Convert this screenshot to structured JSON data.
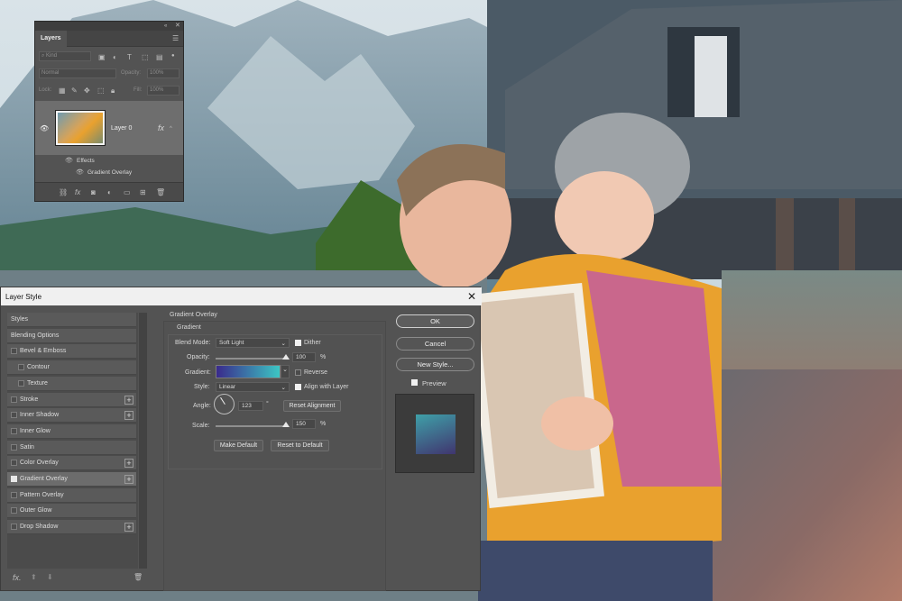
{
  "layers_panel": {
    "title": "Layers",
    "filter_kind": "Kind",
    "blend_mode": "Normal",
    "opacity_label": "Opacity:",
    "opacity_value": "100%",
    "lock_label": "Lock:",
    "fill_label": "Fill:",
    "fill_value": "100%",
    "layer_name": "Layer 0",
    "fx_label": "fx",
    "effects_label": "Effects",
    "effect_item": "Gradient Overlay"
  },
  "dialog": {
    "title": "Layer Style",
    "style_list": [
      {
        "label": "Styles",
        "checkbox": false,
        "checked": false,
        "plus": false,
        "indent": false
      },
      {
        "label": "Blending Options",
        "checkbox": false,
        "checked": false,
        "plus": false,
        "indent": false
      },
      {
        "label": "Bevel & Emboss",
        "checkbox": true,
        "checked": false,
        "plus": false,
        "indent": false
      },
      {
        "label": "Contour",
        "checkbox": true,
        "checked": false,
        "plus": false,
        "indent": true
      },
      {
        "label": "Texture",
        "checkbox": true,
        "checked": false,
        "plus": false,
        "indent": true
      },
      {
        "label": "Stroke",
        "checkbox": true,
        "checked": false,
        "plus": true,
        "indent": false
      },
      {
        "label": "Inner Shadow",
        "checkbox": true,
        "checked": false,
        "plus": true,
        "indent": false
      },
      {
        "label": "Inner Glow",
        "checkbox": true,
        "checked": false,
        "plus": false,
        "indent": false
      },
      {
        "label": "Satin",
        "checkbox": true,
        "checked": false,
        "plus": false,
        "indent": false
      },
      {
        "label": "Color Overlay",
        "checkbox": true,
        "checked": false,
        "plus": true,
        "indent": false
      },
      {
        "label": "Gradient Overlay",
        "checkbox": true,
        "checked": true,
        "plus": true,
        "indent": false
      },
      {
        "label": "Pattern Overlay",
        "checkbox": true,
        "checked": false,
        "plus": false,
        "indent": false
      },
      {
        "label": "Outer Glow",
        "checkbox": true,
        "checked": false,
        "plus": false,
        "indent": false
      },
      {
        "label": "Drop Shadow",
        "checkbox": true,
        "checked": false,
        "plus": true,
        "indent": false
      }
    ],
    "section_title": "Gradient Overlay",
    "group_title": "Gradient",
    "blend_mode_label": "Blend Mode:",
    "blend_mode_value": "Soft Light",
    "dither_label": "Dither",
    "opacity_label": "Opacity:",
    "opacity_value": "100",
    "opacity_fraction": 1.0,
    "percent": "%",
    "gradient_label": "Gradient:",
    "reverse_label": "Reverse",
    "style_label": "Style:",
    "style_value": "Linear",
    "align_label": "Align with Layer",
    "angle_label": "Angle:",
    "angle_value": "123",
    "degree": "°",
    "reset_alignment": "Reset Alignment",
    "scale_label": "Scale:",
    "scale_value": "150",
    "scale_fraction": 1.0,
    "make_default": "Make Default",
    "reset_default": "Reset to Default",
    "ok": "OK",
    "cancel": "Cancel",
    "new_style": "New Style...",
    "preview_label": "Preview",
    "fx_bottom": "fx.",
    "colors": {
      "gradient_start": "#3a2a8c",
      "gradient_end": "#3cc6c4",
      "preview_start": "#3fa0a8",
      "preview_end": "#40356f"
    }
  }
}
